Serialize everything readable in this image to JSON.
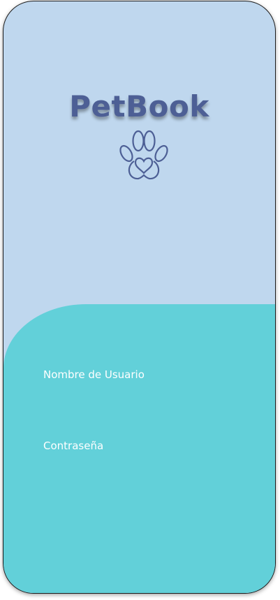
{
  "app": {
    "title": "PetBook"
  },
  "icons": {
    "logo": "paw-heart-icon"
  },
  "colors": {
    "background_top": "#bfd7ee",
    "background_bottom": "#62d0d9",
    "logo": "#4d5f95",
    "label_text": "#ffffff"
  },
  "login": {
    "username_label": "Nombre de Usuario",
    "password_label": "Contraseña",
    "username_value": "",
    "password_value": ""
  }
}
